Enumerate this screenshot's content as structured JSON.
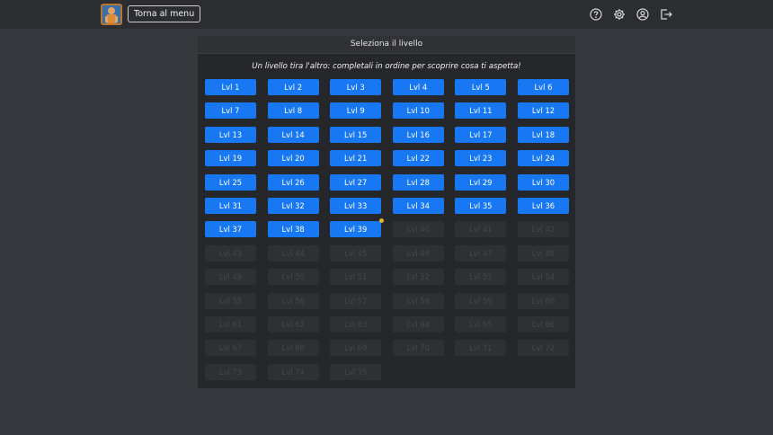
{
  "header": {
    "back_label": "Torna al menu",
    "icons": [
      "help-icon",
      "gear-icon",
      "user-icon",
      "logout-icon"
    ]
  },
  "panel": {
    "title": "Seleziona il livello",
    "subtitle": "Un livello tira l'altro: completali in ordine per scoprire cosa ti aspetta!"
  },
  "levels": {
    "prefix": "Lvl",
    "total": 75,
    "unlocked": 39,
    "current": 39
  },
  "colors": {
    "unlocked": "#1877f2",
    "locked": "#2e3034",
    "current_dot": "#e6b422",
    "background": "#36383e"
  }
}
